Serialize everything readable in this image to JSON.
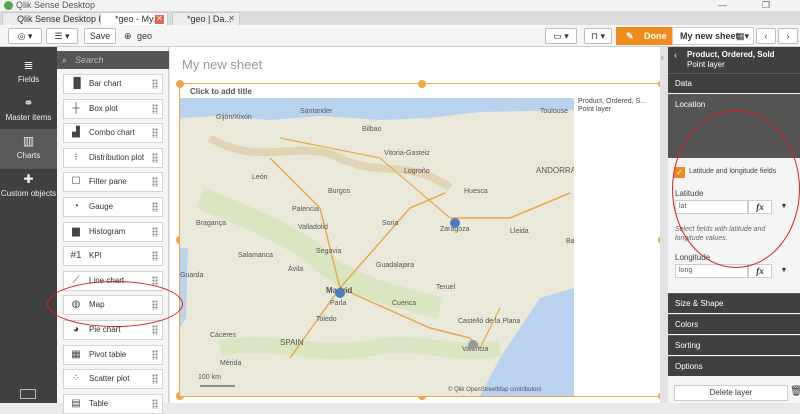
{
  "window": {
    "title": "Qlik Sense Desktop",
    "controls": [
      "—",
      "❐"
    ]
  },
  "tabs": [
    {
      "label": "Qlik Sense Desktop hub",
      "active": false
    },
    {
      "label": "*geo - My...",
      "active": true
    },
    {
      "label": "*geo | Da...",
      "active": false
    }
  ],
  "toolbar": {
    "nav_icon": "compass-icon",
    "list_icon": "list-icon",
    "save_label": "Save",
    "app_name": "geo",
    "done_label": "Done",
    "sheet_name": "My new sheet"
  },
  "rail": [
    {
      "label": "Fields",
      "icon": "database-icon",
      "active": false
    },
    {
      "label": "Master items",
      "icon": "link-icon",
      "active": false
    },
    {
      "label": "Charts",
      "icon": "bar-chart-icon",
      "active": true
    },
    {
      "label": "Custom objects",
      "icon": "puzzle-icon",
      "active": false
    }
  ],
  "assets": {
    "search_placeholder": "Search",
    "items": [
      {
        "label": "Bar chart",
        "icon": "▐▌"
      },
      {
        "label": "Box plot",
        "icon": "┼"
      },
      {
        "label": "Combo chart",
        "icon": "▟"
      },
      {
        "label": "Distribution plot",
        "icon": "⁝"
      },
      {
        "label": "Filter pane",
        "icon": "☐"
      },
      {
        "label": "Gauge",
        "icon": "◔"
      },
      {
        "label": "Histogram",
        "icon": "▆"
      },
      {
        "label": "KPI",
        "icon": "#1"
      },
      {
        "label": "Line chart",
        "icon": "⟋"
      },
      {
        "label": "Map",
        "icon": "◍"
      },
      {
        "label": "Pie chart",
        "icon": "◕"
      },
      {
        "label": "Pivot table",
        "icon": "▦"
      },
      {
        "label": "Scatter plot",
        "icon": "⁘"
      },
      {
        "label": "Table",
        "icon": "▤"
      }
    ]
  },
  "sheet": {
    "title": "My new sheet",
    "object_title_placeholder": "Click to add title",
    "legend": "Product, Ordered, S... Point layer",
    "scale": "100 km",
    "attribution": "© Qlik OpenStreetMap contributors",
    "cities": [
      {
        "name": "Gijón/Xixón"
      },
      {
        "name": "Santander"
      },
      {
        "name": "Bilbao"
      },
      {
        "name": "Toulouse"
      },
      {
        "name": "Vitoria-Gasteiz"
      },
      {
        "name": "León"
      },
      {
        "name": "Burgos"
      },
      {
        "name": "Logroño"
      },
      {
        "name": "Huesca"
      },
      {
        "name": "ANDORRA"
      },
      {
        "name": "Palencia"
      },
      {
        "name": "Bragança"
      },
      {
        "name": "Valladolid"
      },
      {
        "name": "Soria"
      },
      {
        "name": "Zaragoza"
      },
      {
        "name": "Lleida"
      },
      {
        "name": "Salamanca"
      },
      {
        "name": "Segovia"
      },
      {
        "name": "Ávila"
      },
      {
        "name": "Guadalajara"
      },
      {
        "name": "Guarda"
      },
      {
        "name": "Madrid"
      },
      {
        "name": "Parla"
      },
      {
        "name": "Teruel"
      },
      {
        "name": "Cuenca"
      },
      {
        "name": "Toledo"
      },
      {
        "name": "Castelló de la Plana"
      },
      {
        "name": "Cáceres"
      },
      {
        "name": "SPAIN"
      },
      {
        "name": "Mérida"
      },
      {
        "name": "Valencia"
      },
      {
        "name": "Ba"
      }
    ],
    "points": [
      {
        "city": "Zaragoza",
        "color": "#4a7ec0"
      },
      {
        "city": "Madrid",
        "color": "#4a7ec0"
      },
      {
        "city": "Valencia",
        "color": "#999999"
      }
    ]
  },
  "properties": {
    "header_title": "Product, Ordered, Sold",
    "header_subtitle": "Point layer",
    "sections": {
      "data": "Data",
      "location": "Location",
      "size_shape": "Size & Shape",
      "colors": "Colors",
      "sorting": "Sorting",
      "options": "Options"
    },
    "latlong_label": "Latitude and longitude fields",
    "latitude_label": "Latitude",
    "latitude_value": "lat",
    "hint": "Select fields with latitude and longitude values.",
    "longitude_label": "Longitude",
    "longitude_value": "long",
    "fx_label": "fx",
    "delete_label": "Delete layer"
  },
  "colors": {
    "accent": "#f08c1e",
    "rail": "#404040",
    "annotation": "#d52020"
  }
}
